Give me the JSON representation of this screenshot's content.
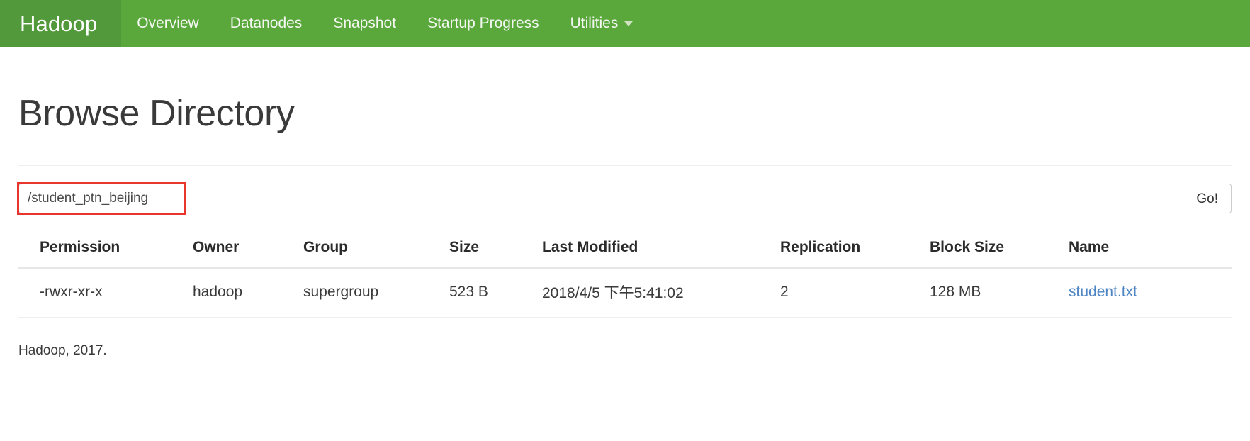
{
  "navbar": {
    "brand": "Hadoop",
    "brand_color": "#5aa83c",
    "brand_active_color": "#51993a",
    "items": [
      {
        "label": "Overview",
        "has_caret": false
      },
      {
        "label": "Datanodes",
        "has_caret": false
      },
      {
        "label": "Snapshot",
        "has_caret": false
      },
      {
        "label": "Startup Progress",
        "has_caret": false
      },
      {
        "label": "Utilities",
        "has_caret": true
      }
    ]
  },
  "page": {
    "title": "Browse Directory"
  },
  "path_form": {
    "value": "/student_ptn_beijing",
    "placeholder": "",
    "go_label": "Go!",
    "annotation_color": "#e8352e"
  },
  "table": {
    "headers": [
      "Permission",
      "Owner",
      "Group",
      "Size",
      "Last Modified",
      "Replication",
      "Block Size",
      "Name"
    ],
    "rows": [
      {
        "permission": "-rwxr-xr-x",
        "owner": "hadoop",
        "group": "supergroup",
        "size": "523 B",
        "last_modified": "2018/4/5 下午5:41:02",
        "replication": "2",
        "block_size": "128 MB",
        "name": "student.txt",
        "name_color": "#4c84c4"
      }
    ]
  },
  "footer": {
    "text": "Hadoop, 2017."
  }
}
